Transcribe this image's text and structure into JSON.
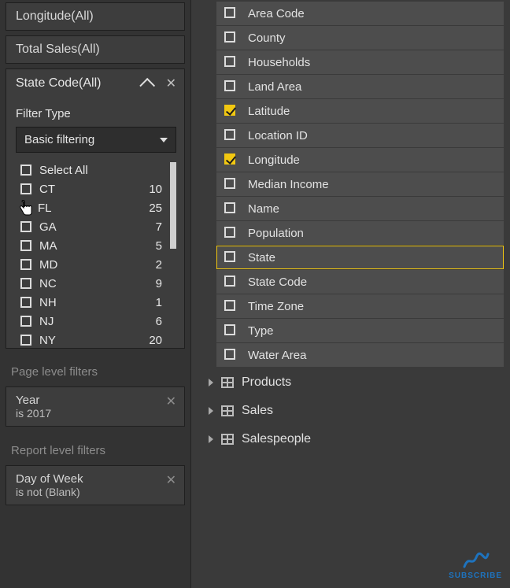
{
  "left": {
    "cards": [
      {
        "title": "Longitude(All)"
      },
      {
        "title": "Total Sales(All)"
      }
    ],
    "state": {
      "title": "State Code(All)",
      "filterTypeLabel": "Filter Type",
      "filterTypeValue": "Basic filtering",
      "values": [
        {
          "label": "Select All",
          "count": ""
        },
        {
          "label": "CT",
          "count": "10"
        },
        {
          "label": "FL",
          "count": "25"
        },
        {
          "label": "GA",
          "count": "7"
        },
        {
          "label": "MA",
          "count": "5"
        },
        {
          "label": "MD",
          "count": "2"
        },
        {
          "label": "NC",
          "count": "9"
        },
        {
          "label": "NH",
          "count": "1"
        },
        {
          "label": "NJ",
          "count": "6"
        },
        {
          "label": "NY",
          "count": "20"
        }
      ]
    },
    "pageLevelLabel": "Page level filters",
    "pageFilter": {
      "line1": "Year",
      "line2": "is 2017"
    },
    "reportLevelLabel": "Report level filters",
    "reportFilter": {
      "line1": "Day of Week",
      "line2": "is not (Blank)"
    }
  },
  "fields": [
    {
      "label": "Area Code",
      "checked": false,
      "selected": false
    },
    {
      "label": "County",
      "checked": false,
      "selected": false
    },
    {
      "label": "Households",
      "checked": false,
      "selected": false
    },
    {
      "label": "Land Area",
      "checked": false,
      "selected": false
    },
    {
      "label": "Latitude",
      "checked": true,
      "selected": false
    },
    {
      "label": "Location ID",
      "checked": false,
      "selected": false
    },
    {
      "label": "Longitude",
      "checked": true,
      "selected": false
    },
    {
      "label": "Median Income",
      "checked": false,
      "selected": false
    },
    {
      "label": "Name",
      "checked": false,
      "selected": false
    },
    {
      "label": "Population",
      "checked": false,
      "selected": false
    },
    {
      "label": "State",
      "checked": false,
      "selected": true
    },
    {
      "label": "State Code",
      "checked": false,
      "selected": false
    },
    {
      "label": "Time Zone",
      "checked": false,
      "selected": false
    },
    {
      "label": "Type",
      "checked": false,
      "selected": false
    },
    {
      "label": "Water Area",
      "checked": false,
      "selected": false
    }
  ],
  "tables": [
    {
      "label": "Products"
    },
    {
      "label": "Sales"
    },
    {
      "label": "Salespeople"
    }
  ],
  "subscribe": "SUBSCRIBE"
}
